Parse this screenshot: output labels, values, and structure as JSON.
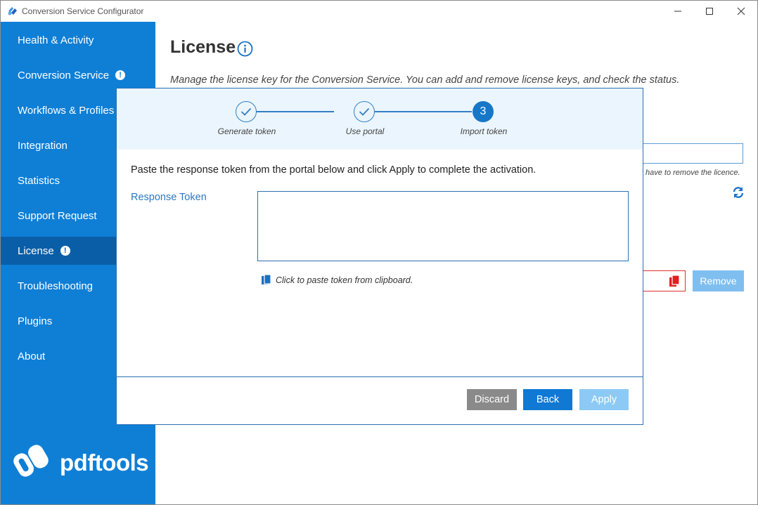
{
  "window": {
    "title": "Conversion Service Configurator"
  },
  "sidebar": {
    "items": [
      {
        "label": "Health & Activity",
        "alert": false,
        "active": false
      },
      {
        "label": "Conversion Service",
        "alert": true,
        "active": false
      },
      {
        "label": "Workflows & Profiles",
        "alert": false,
        "active": false
      },
      {
        "label": "Integration",
        "alert": false,
        "active": false
      },
      {
        "label": "Statistics",
        "alert": false,
        "active": false
      },
      {
        "label": "Support Request",
        "alert": false,
        "active": false
      },
      {
        "label": "License",
        "alert": true,
        "active": true
      },
      {
        "label": "Troubleshooting",
        "alert": false,
        "active": false
      },
      {
        "label": "Plugins",
        "alert": false,
        "active": false
      },
      {
        "label": "About",
        "alert": false,
        "active": false
      }
    ],
    "logo_text": "pdftools",
    "alert_glyph": "!"
  },
  "main": {
    "title": "License",
    "description": "Manage the license key for the Conversion Service. You can add and remove license keys, and check the status.",
    "partial_note": "have to remove the licence.",
    "remove_label": "Remove"
  },
  "dialog": {
    "steps": [
      {
        "label": "Generate token",
        "state": "done",
        "number": ""
      },
      {
        "label": "Use portal",
        "state": "done",
        "number": ""
      },
      {
        "label": "Import token",
        "state": "current",
        "number": "3"
      }
    ],
    "instruction": "Paste the response token from the portal below and click Apply to complete the activation.",
    "token_label": "Response Token",
    "token_value": "",
    "paste_hint": "Click to paste token from clipboard.",
    "buttons": {
      "discard": "Discard",
      "back": "Back",
      "apply": "Apply"
    }
  },
  "colors": {
    "sidebar": "#0f7fd6",
    "sidebar_active": "#0a5ea8",
    "accent": "#1677c8",
    "discard": "#8a8a8a",
    "apply_disabled": "#8ccaf5",
    "remove_disabled": "#7fbff0",
    "wizard_bg": "#ebf5fd"
  },
  "icons": [
    "app-icon",
    "minimize-icon",
    "maximize-icon",
    "close-icon",
    "alert-icon",
    "info-icon",
    "refresh-icon",
    "copy-icon",
    "checkmark-icon",
    "paste-icon",
    "pdftools-logo-icon"
  ]
}
